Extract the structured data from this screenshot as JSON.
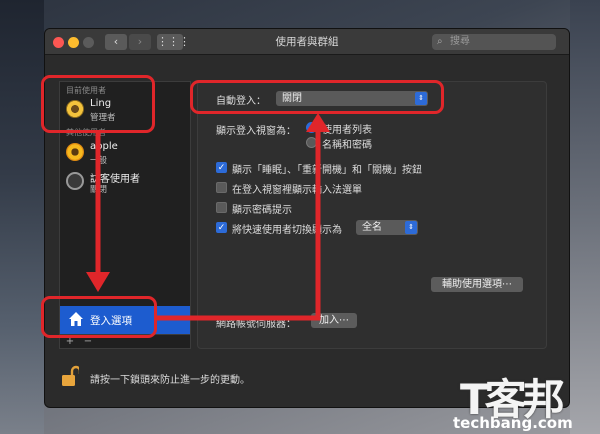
{
  "window": {
    "title": "使用者與群組",
    "search_placeholder": "搜尋"
  },
  "sidebar": {
    "current_user_section": "目前使用者",
    "other_users_section": "其他使用者",
    "current_user": {
      "name": "Ling",
      "role": "管理者"
    },
    "users": [
      {
        "name": "apple",
        "role": "一般"
      },
      {
        "name": "訪客使用者",
        "role": "關閉"
      }
    ],
    "login_options_label": "登入選項",
    "add_label": "+",
    "remove_label": "−"
  },
  "panel": {
    "auto_login_label": "自動登入：",
    "auto_login_value": "關閉",
    "display_window_label": "顯示登入視窗為：",
    "display_options": [
      {
        "label": "使用者列表",
        "selected": true
      },
      {
        "label": "名稱和密碼",
        "selected": false
      }
    ],
    "checkboxes": [
      {
        "label": "顯示「睡眠」、「重新開機」和「關機」按鈕",
        "checked": true
      },
      {
        "label": "在登入視窗裡顯示輸入法選單",
        "checked": false
      },
      {
        "label": "顯示密碼提示",
        "checked": false
      },
      {
        "label": "將快速使用者切換顯示為",
        "checked": true
      }
    ],
    "fast_switch_value": "全名",
    "accessibility_button": "輔助使用選項⋯",
    "network_account_label": "網路帳號伺服器：",
    "join_button": "加入⋯"
  },
  "lockbar": {
    "text": "請按一下鎖頭來防止進一步的更動。"
  },
  "watermark": {
    "cn": "T客邦",
    "en": "techbang.com"
  },
  "colors": {
    "annotation": "#e0262a",
    "selection": "#1d5ccf",
    "accent": "#2d6bd8"
  }
}
